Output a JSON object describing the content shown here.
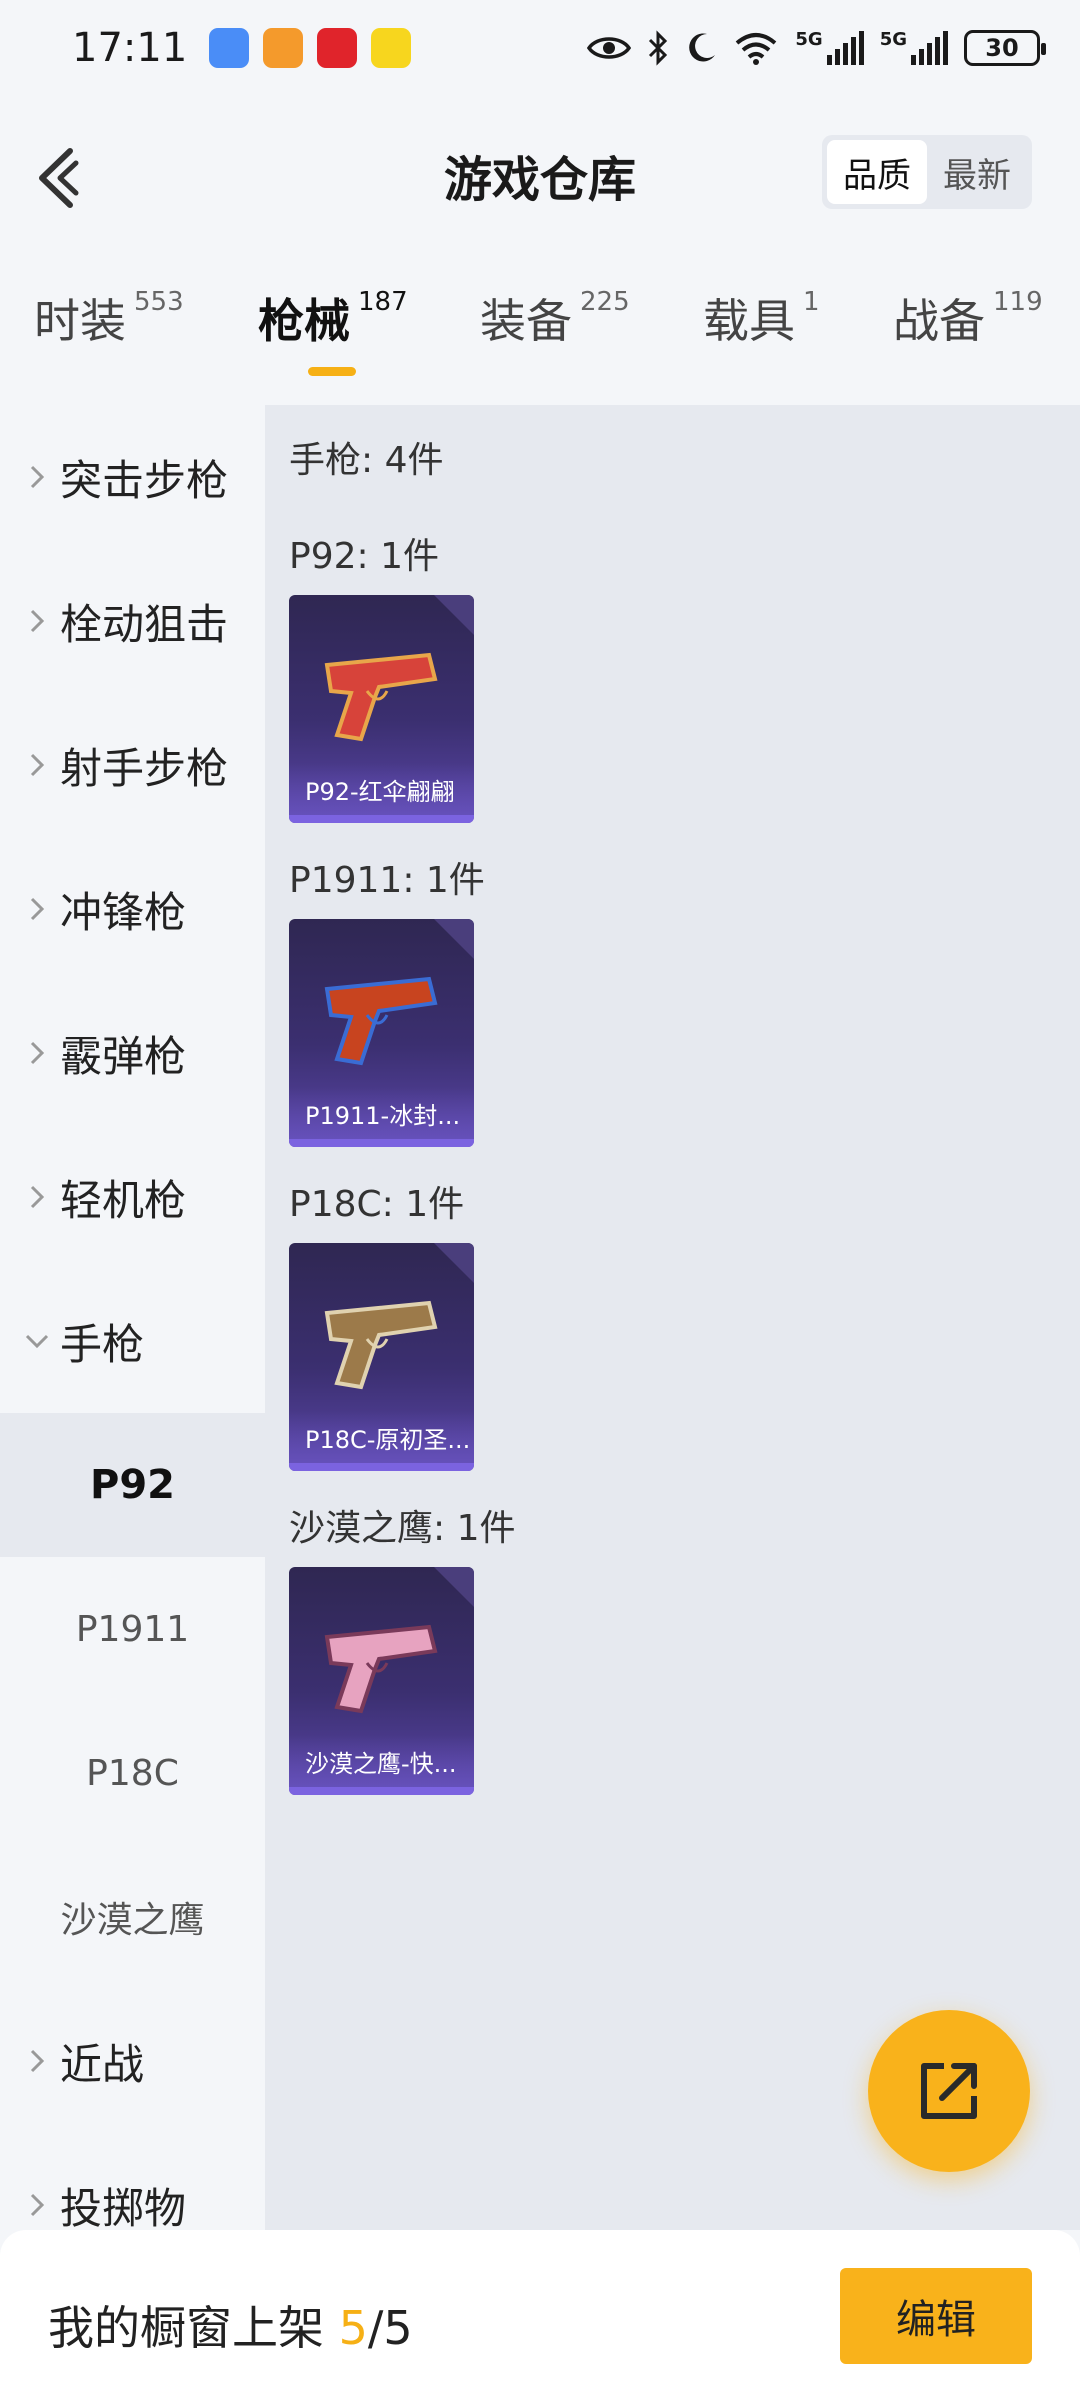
{
  "status_bar": {
    "time": "17:11",
    "apps": [
      {
        "name": "app-blue-icon",
        "color": "#4a8df7"
      },
      {
        "name": "app-orange-icon",
        "color": "#f49a2c"
      },
      {
        "name": "app-red-icon",
        "color": "#e0242b"
      },
      {
        "name": "app-yellow-icon",
        "color": "#f7d61e"
      }
    ],
    "net1": "5G",
    "net2": "5G",
    "battery": "30"
  },
  "header": {
    "title": "游戏仓库",
    "sort_options": [
      "品质",
      "最新"
    ],
    "sort_active": "品质"
  },
  "tabs": [
    {
      "label": "时装",
      "count": "553"
    },
    {
      "label": "枪械",
      "count": "187"
    },
    {
      "label": "装备",
      "count": "225"
    },
    {
      "label": "载具",
      "count": "1"
    },
    {
      "label": "战备",
      "count": "119"
    }
  ],
  "active_tab": "枪械",
  "sidebar": {
    "categories": [
      {
        "label": "突击步枪",
        "expanded": false
      },
      {
        "label": "栓动狙击",
        "expanded": false
      },
      {
        "label": "射手步枪",
        "expanded": false
      },
      {
        "label": "冲锋枪",
        "expanded": false
      },
      {
        "label": "霰弹枪",
        "expanded": false
      },
      {
        "label": "轻机枪",
        "expanded": false
      },
      {
        "label": "手枪",
        "expanded": true
      }
    ],
    "sub_items": [
      "P92",
      "P1911",
      "P18C",
      "沙漠之鹰"
    ],
    "active_sub": "P92",
    "bottom_categories": [
      {
        "label": "近战"
      },
      {
        "label": "投掷物"
      }
    ]
  },
  "content": {
    "summary": "手枪: 4件",
    "groups": [
      {
        "header": "P92: 1件",
        "item": "P92-红伞翩翩",
        "gun_color": "#d7433a",
        "accent": "#e8a64a"
      },
      {
        "header": "P1911: 1件",
        "item": "P1911-冰封...",
        "gun_color": "#c8441f",
        "accent": "#3a6cd4"
      },
      {
        "header": "P18C: 1件",
        "item": "P18C-原初圣...",
        "gun_color": "#9c7a4a",
        "accent": "#e0d2b0"
      },
      {
        "header": "沙漠之鹰: 1件",
        "item": "沙漠之鹰-快...",
        "gun_color": "#e7a3c0",
        "accent": "#7a3a5a"
      }
    ]
  },
  "bottom": {
    "showcase_label": "我的橱窗上架",
    "showcase_count": "5",
    "showcase_sep": "/",
    "showcase_total": "5",
    "edit_label": "编辑"
  },
  "colors": {
    "accent": "#f9b21b",
    "card_bg": "#3b2f70",
    "content_bg": "#e6e9ef"
  }
}
